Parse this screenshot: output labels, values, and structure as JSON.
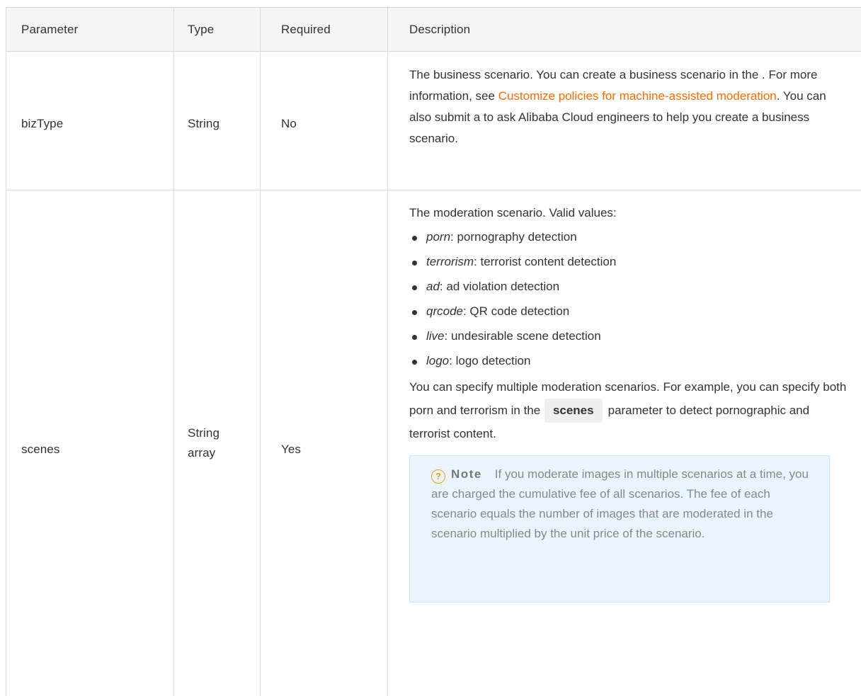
{
  "table": {
    "headers": {
      "parameter": "Parameter",
      "type": "Type",
      "required": "Required",
      "description": "Description"
    },
    "rows": [
      {
        "parameter": "bizType",
        "type": "String",
        "required": "No",
        "description": {
          "text_before_link": "The business scenario. You can create a business scenario in the . For more information, see ",
          "link_text": "Customize policies for machine-assisted moderation",
          "text_after_link": ". You can also submit a to ask Alibaba Cloud engineers to help you create a business scenario."
        }
      },
      {
        "parameter": "scenes",
        "type_line1": "String",
        "type_line2": "array",
        "required": "Yes",
        "description": {
          "intro": "The moderation scenario. Valid values:",
          "values": [
            {
              "term": "porn",
              "text": ": pornography detection"
            },
            {
              "term": "terrorism",
              "text": ": terrorist content detection"
            },
            {
              "term": "ad",
              "text": ": ad violation detection"
            },
            {
              "term": "qrcode",
              "text": ": QR code detection"
            },
            {
              "term": "live",
              "text": ": undesirable scene detection"
            },
            {
              "term": "logo",
              "text": ": logo detection"
            }
          ],
          "multi_text_before": "You can specify multiple moderation scenarios. For example, you can specify both porn and terrorism in the",
          "code": "scenes",
          "multi_text_after": "parameter to detect pornographic and terrorist content.",
          "note": {
            "icon": "question-circle-icon",
            "label": "Note",
            "text": "If you moderate images in multiple scenarios at a time, you are charged the cumulative fee of all scenarios. The fee of each scenario equals the number of images that are moderated in the scenario multiplied by the unit price of the scenario."
          }
        }
      }
    ]
  },
  "colors": {
    "link": "#ff6a00",
    "header_bg": "#f5f5f5",
    "border": "#d9d9d9",
    "note_bg": "#e9f5fe",
    "note_icon": "#f29b00"
  }
}
